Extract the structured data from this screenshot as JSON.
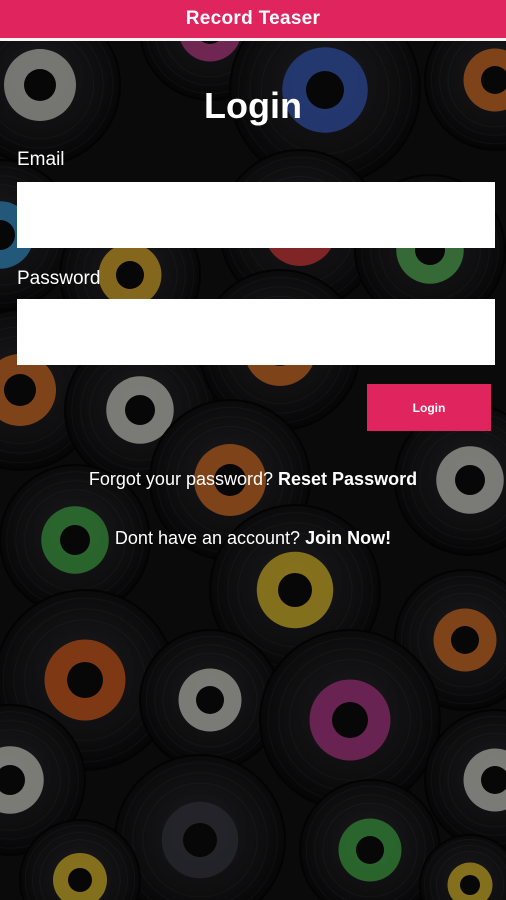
{
  "app": {
    "title": "Record Teaser",
    "accent_color": "#e0245e"
  },
  "login": {
    "heading": "Login",
    "email_label": "Email",
    "email_value": "",
    "password_label": "Password",
    "password_value": "",
    "submit_label": "Login"
  },
  "links": {
    "forgot_prompt": "Forgot your password?",
    "forgot_action": "Reset Password",
    "signup_prompt": "Dont have an account?",
    "signup_action": "Join Now!"
  },
  "background": {
    "description_icon": "vinyl-records-icon"
  }
}
